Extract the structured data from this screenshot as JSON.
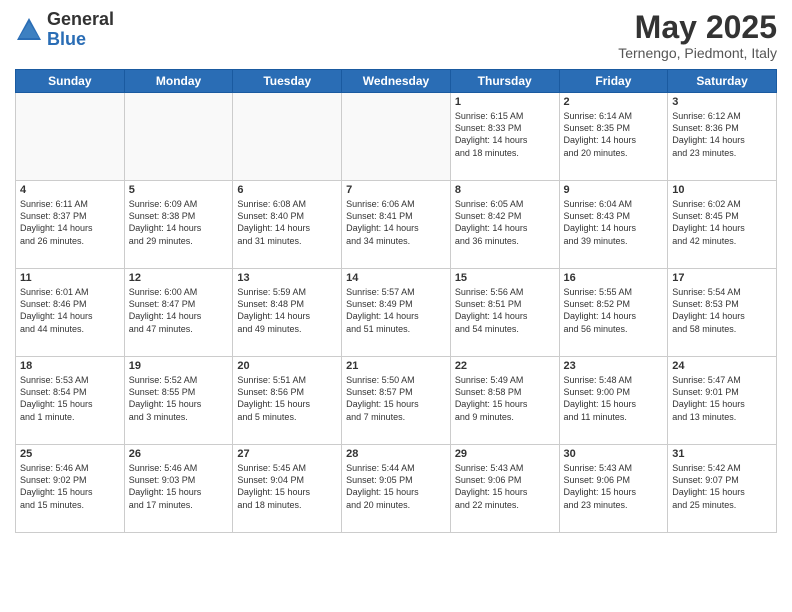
{
  "header": {
    "logo_general": "General",
    "logo_blue": "Blue",
    "month": "May 2025",
    "location": "Ternengo, Piedmont, Italy"
  },
  "days_of_week": [
    "Sunday",
    "Monday",
    "Tuesday",
    "Wednesday",
    "Thursday",
    "Friday",
    "Saturday"
  ],
  "weeks": [
    [
      {
        "day": "",
        "text": ""
      },
      {
        "day": "",
        "text": ""
      },
      {
        "day": "",
        "text": ""
      },
      {
        "day": "",
        "text": ""
      },
      {
        "day": "1",
        "text": "Sunrise: 6:15 AM\nSunset: 8:33 PM\nDaylight: 14 hours\nand 18 minutes."
      },
      {
        "day": "2",
        "text": "Sunrise: 6:14 AM\nSunset: 8:35 PM\nDaylight: 14 hours\nand 20 minutes."
      },
      {
        "day": "3",
        "text": "Sunrise: 6:12 AM\nSunset: 8:36 PM\nDaylight: 14 hours\nand 23 minutes."
      }
    ],
    [
      {
        "day": "4",
        "text": "Sunrise: 6:11 AM\nSunset: 8:37 PM\nDaylight: 14 hours\nand 26 minutes."
      },
      {
        "day": "5",
        "text": "Sunrise: 6:09 AM\nSunset: 8:38 PM\nDaylight: 14 hours\nand 29 minutes."
      },
      {
        "day": "6",
        "text": "Sunrise: 6:08 AM\nSunset: 8:40 PM\nDaylight: 14 hours\nand 31 minutes."
      },
      {
        "day": "7",
        "text": "Sunrise: 6:06 AM\nSunset: 8:41 PM\nDaylight: 14 hours\nand 34 minutes."
      },
      {
        "day": "8",
        "text": "Sunrise: 6:05 AM\nSunset: 8:42 PM\nDaylight: 14 hours\nand 36 minutes."
      },
      {
        "day": "9",
        "text": "Sunrise: 6:04 AM\nSunset: 8:43 PM\nDaylight: 14 hours\nand 39 minutes."
      },
      {
        "day": "10",
        "text": "Sunrise: 6:02 AM\nSunset: 8:45 PM\nDaylight: 14 hours\nand 42 minutes."
      }
    ],
    [
      {
        "day": "11",
        "text": "Sunrise: 6:01 AM\nSunset: 8:46 PM\nDaylight: 14 hours\nand 44 minutes."
      },
      {
        "day": "12",
        "text": "Sunrise: 6:00 AM\nSunset: 8:47 PM\nDaylight: 14 hours\nand 47 minutes."
      },
      {
        "day": "13",
        "text": "Sunrise: 5:59 AM\nSunset: 8:48 PM\nDaylight: 14 hours\nand 49 minutes."
      },
      {
        "day": "14",
        "text": "Sunrise: 5:57 AM\nSunset: 8:49 PM\nDaylight: 14 hours\nand 51 minutes."
      },
      {
        "day": "15",
        "text": "Sunrise: 5:56 AM\nSunset: 8:51 PM\nDaylight: 14 hours\nand 54 minutes."
      },
      {
        "day": "16",
        "text": "Sunrise: 5:55 AM\nSunset: 8:52 PM\nDaylight: 14 hours\nand 56 minutes."
      },
      {
        "day": "17",
        "text": "Sunrise: 5:54 AM\nSunset: 8:53 PM\nDaylight: 14 hours\nand 58 minutes."
      }
    ],
    [
      {
        "day": "18",
        "text": "Sunrise: 5:53 AM\nSunset: 8:54 PM\nDaylight: 15 hours\nand 1 minute."
      },
      {
        "day": "19",
        "text": "Sunrise: 5:52 AM\nSunset: 8:55 PM\nDaylight: 15 hours\nand 3 minutes."
      },
      {
        "day": "20",
        "text": "Sunrise: 5:51 AM\nSunset: 8:56 PM\nDaylight: 15 hours\nand 5 minutes."
      },
      {
        "day": "21",
        "text": "Sunrise: 5:50 AM\nSunset: 8:57 PM\nDaylight: 15 hours\nand 7 minutes."
      },
      {
        "day": "22",
        "text": "Sunrise: 5:49 AM\nSunset: 8:58 PM\nDaylight: 15 hours\nand 9 minutes."
      },
      {
        "day": "23",
        "text": "Sunrise: 5:48 AM\nSunset: 9:00 PM\nDaylight: 15 hours\nand 11 minutes."
      },
      {
        "day": "24",
        "text": "Sunrise: 5:47 AM\nSunset: 9:01 PM\nDaylight: 15 hours\nand 13 minutes."
      }
    ],
    [
      {
        "day": "25",
        "text": "Sunrise: 5:46 AM\nSunset: 9:02 PM\nDaylight: 15 hours\nand 15 minutes."
      },
      {
        "day": "26",
        "text": "Sunrise: 5:46 AM\nSunset: 9:03 PM\nDaylight: 15 hours\nand 17 minutes."
      },
      {
        "day": "27",
        "text": "Sunrise: 5:45 AM\nSunset: 9:04 PM\nDaylight: 15 hours\nand 18 minutes."
      },
      {
        "day": "28",
        "text": "Sunrise: 5:44 AM\nSunset: 9:05 PM\nDaylight: 15 hours\nand 20 minutes."
      },
      {
        "day": "29",
        "text": "Sunrise: 5:43 AM\nSunset: 9:06 PM\nDaylight: 15 hours\nand 22 minutes."
      },
      {
        "day": "30",
        "text": "Sunrise: 5:43 AM\nSunset: 9:06 PM\nDaylight: 15 hours\nand 23 minutes."
      },
      {
        "day": "31",
        "text": "Sunrise: 5:42 AM\nSunset: 9:07 PM\nDaylight: 15 hours\nand 25 minutes."
      }
    ]
  ]
}
